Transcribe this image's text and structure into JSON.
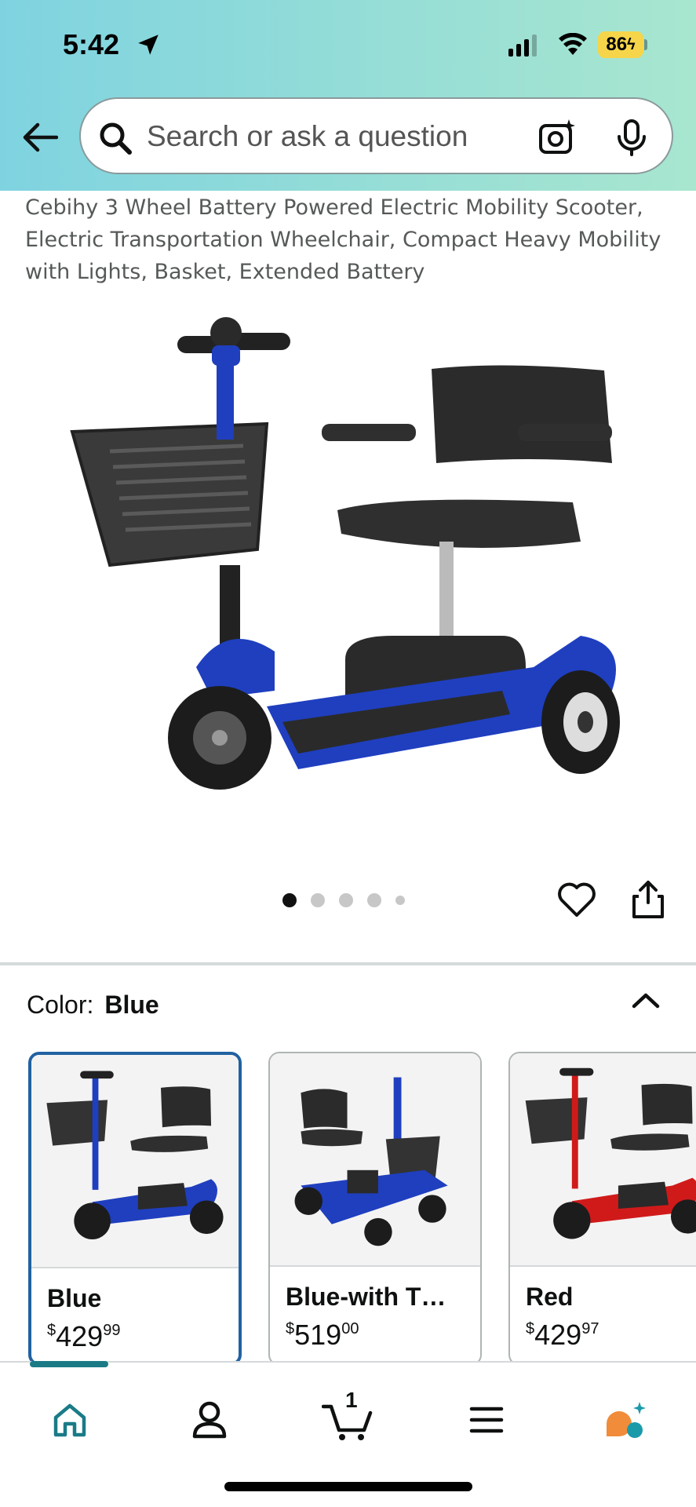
{
  "status_bar": {
    "time": "5:42",
    "battery": "86",
    "icons": [
      "location-arrow-icon",
      "cellular-signal-icon",
      "wifi-icon",
      "battery-charging-icon"
    ]
  },
  "search": {
    "placeholder": "Search or ask a question",
    "icons": [
      "back-arrow-icon",
      "search-icon",
      "camera-lens-icon",
      "microphone-icon"
    ]
  },
  "product": {
    "title": "Cebihy 3 Wheel Battery Powered Electric Mobility Scooter, Electric Transportation Wheelchair, Compact Heavy Mobility with Lights, Basket, Extended Battery",
    "image_count": 5,
    "active_image": 1
  },
  "color_selector": {
    "label": "Color:",
    "selected": "Blue",
    "options": [
      {
        "name": "Blue",
        "price_currency": "$",
        "price_whole": "429",
        "price_cents": "99",
        "selected": true,
        "accent": "#1f3fbf"
      },
      {
        "name": "Blue-with T…",
        "price_currency": "$",
        "price_whole": "519",
        "price_cents": "00",
        "selected": false,
        "accent": "#1f3fbf"
      },
      {
        "name": "Red",
        "price_currency": "$",
        "price_whole": "429",
        "price_cents": "97",
        "selected": false,
        "accent": "#d01a1a"
      }
    ]
  },
  "bottom_nav": {
    "items": [
      "home-icon",
      "account-icon",
      "cart-icon",
      "menu-icon",
      "rufus-assistant-icon"
    ],
    "cart_count": "1",
    "active": "home"
  },
  "colors": {
    "header_gradient_start": "#7fd3e0",
    "header_gradient_end": "#a8e6cf",
    "selected_border": "#2162a1",
    "nav_active": "#1a7b87",
    "scooter_blue": "#1f3fbf",
    "battery_badge": "#f6d54a"
  }
}
